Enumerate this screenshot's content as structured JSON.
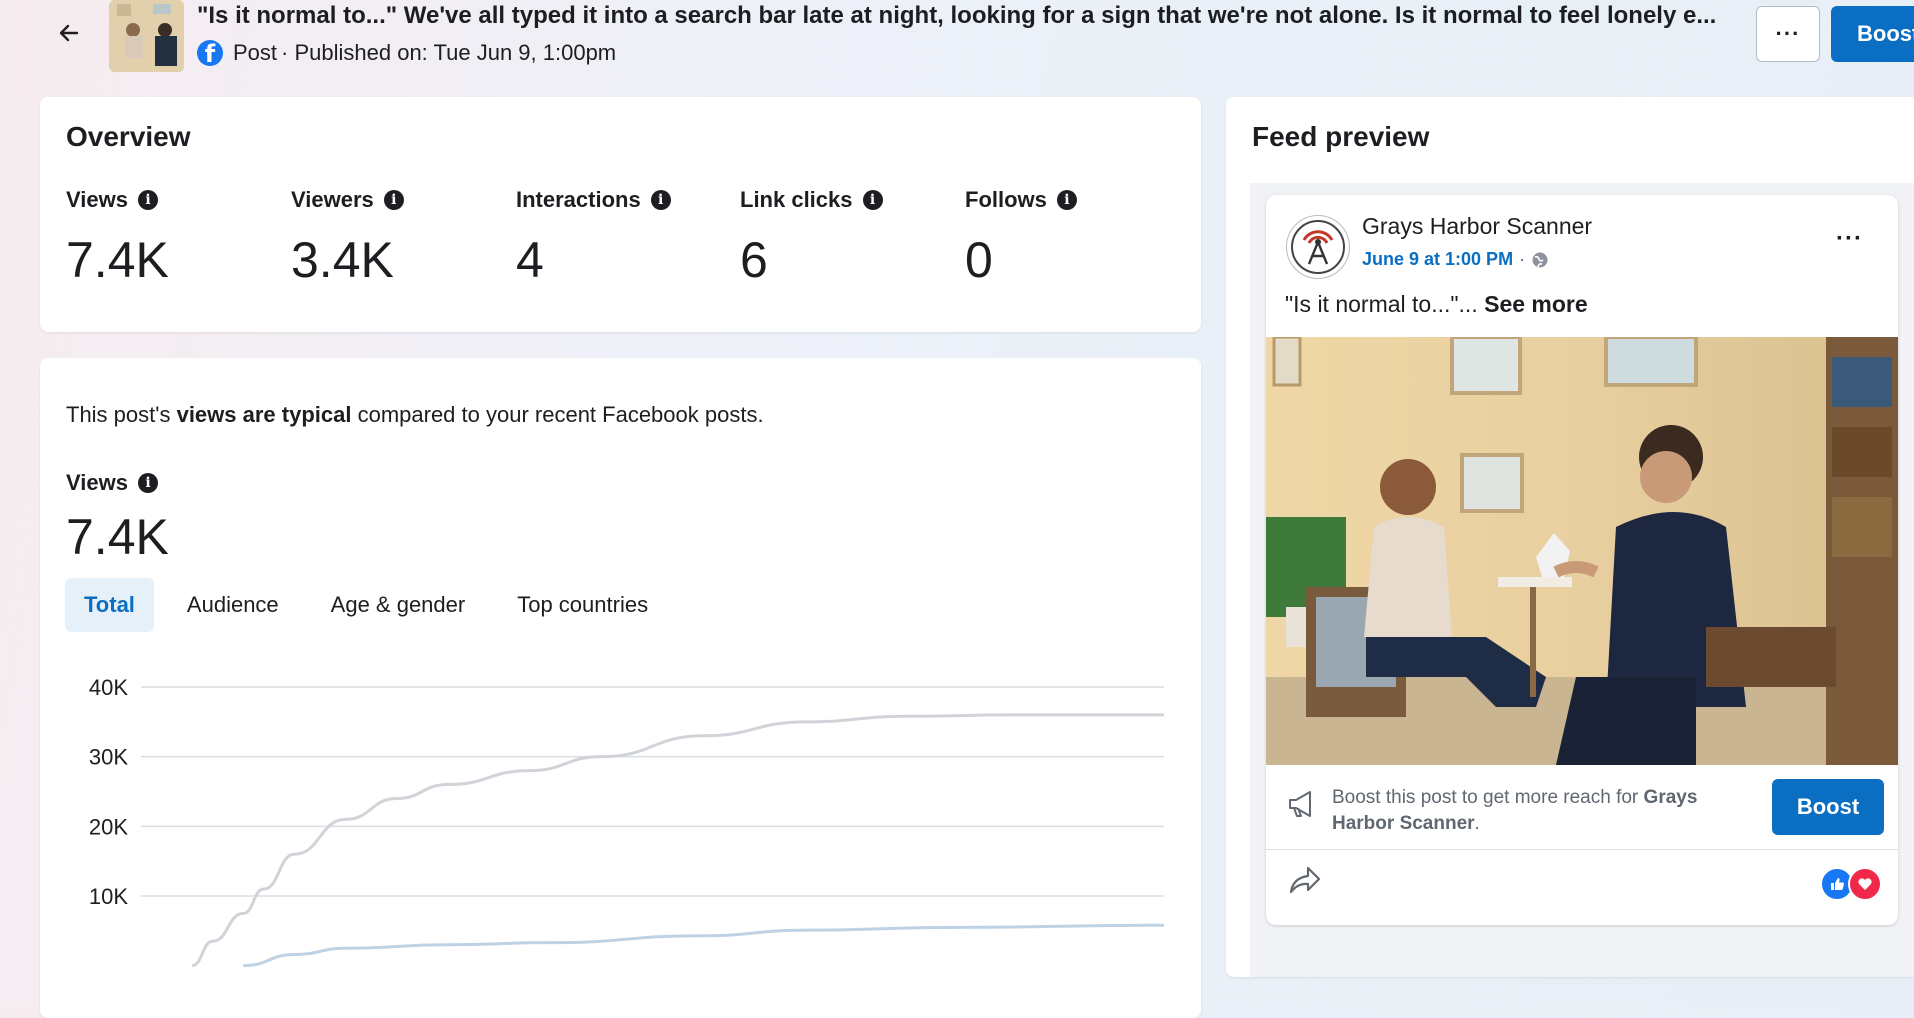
{
  "header": {
    "title": "\"Is it normal to...\" We've all typed it into a search bar late at night, looking for a sign that we're not alone. Is it normal to feel lonely e...",
    "post_type": "Post",
    "published": "· Published on: Tue Jun 9, 1:00pm",
    "more_label": "···",
    "boost_label": "Boost"
  },
  "overview": {
    "title": "Overview",
    "metrics": [
      {
        "label": "Views",
        "value": "7.4K"
      },
      {
        "label": "Viewers",
        "value": "3.4K"
      },
      {
        "label": "Interactions",
        "value": "4"
      },
      {
        "label": "Link clicks",
        "value": "6"
      },
      {
        "label": "Follows",
        "value": "0"
      }
    ]
  },
  "performance": {
    "text_pre": "This post's ",
    "text_bold": "views are typical",
    "text_post": " compared to your recent Facebook posts.",
    "views_label": "Views",
    "views_value": "7.4K",
    "tabs": [
      "Total",
      "Audience",
      "Age & gender",
      "Top countries"
    ],
    "active_tab": "Total"
  },
  "chart_data": {
    "type": "line",
    "y_ticks": [
      "40K",
      "30K",
      "20K",
      "10K"
    ],
    "ylim": [
      0,
      40000
    ],
    "series": [
      {
        "color": "#d0d3d8",
        "points": [
          [
            0.05,
            0
          ],
          [
            0.07,
            3500
          ],
          [
            0.1,
            7500
          ],
          [
            0.12,
            11000
          ],
          [
            0.15,
            16000
          ],
          [
            0.2,
            21000
          ],
          [
            0.25,
            24000
          ],
          [
            0.3,
            26000
          ],
          [
            0.38,
            28000
          ],
          [
            0.45,
            30000
          ],
          [
            0.55,
            33000
          ],
          [
            0.65,
            35000
          ],
          [
            0.75,
            35800
          ],
          [
            0.85,
            36000
          ],
          [
            1.0,
            36000
          ]
        ]
      },
      {
        "color": "#bfd2e3",
        "points": [
          [
            0.1,
            0
          ],
          [
            0.15,
            1600
          ],
          [
            0.2,
            2500
          ],
          [
            0.3,
            3000
          ],
          [
            0.4,
            3300
          ],
          [
            0.55,
            4300
          ],
          [
            0.65,
            5100
          ],
          [
            0.8,
            5500
          ],
          [
            1.0,
            5800
          ]
        ]
      }
    ]
  },
  "feed": {
    "title": "Feed preview",
    "page_name": "Grays Harbor Scanner",
    "post_date": "June 9 at 1:00 PM",
    "dots": "···",
    "post_text": "\"Is it normal to...\"...",
    "see_more": " See more",
    "boost_text_pre": "Boost this post to get more reach for ",
    "boost_text_bold": "Grays Harbor Scanner",
    "boost_text_post": ".",
    "boost_label": "Boost",
    "reactions": [
      "like",
      "love"
    ]
  }
}
